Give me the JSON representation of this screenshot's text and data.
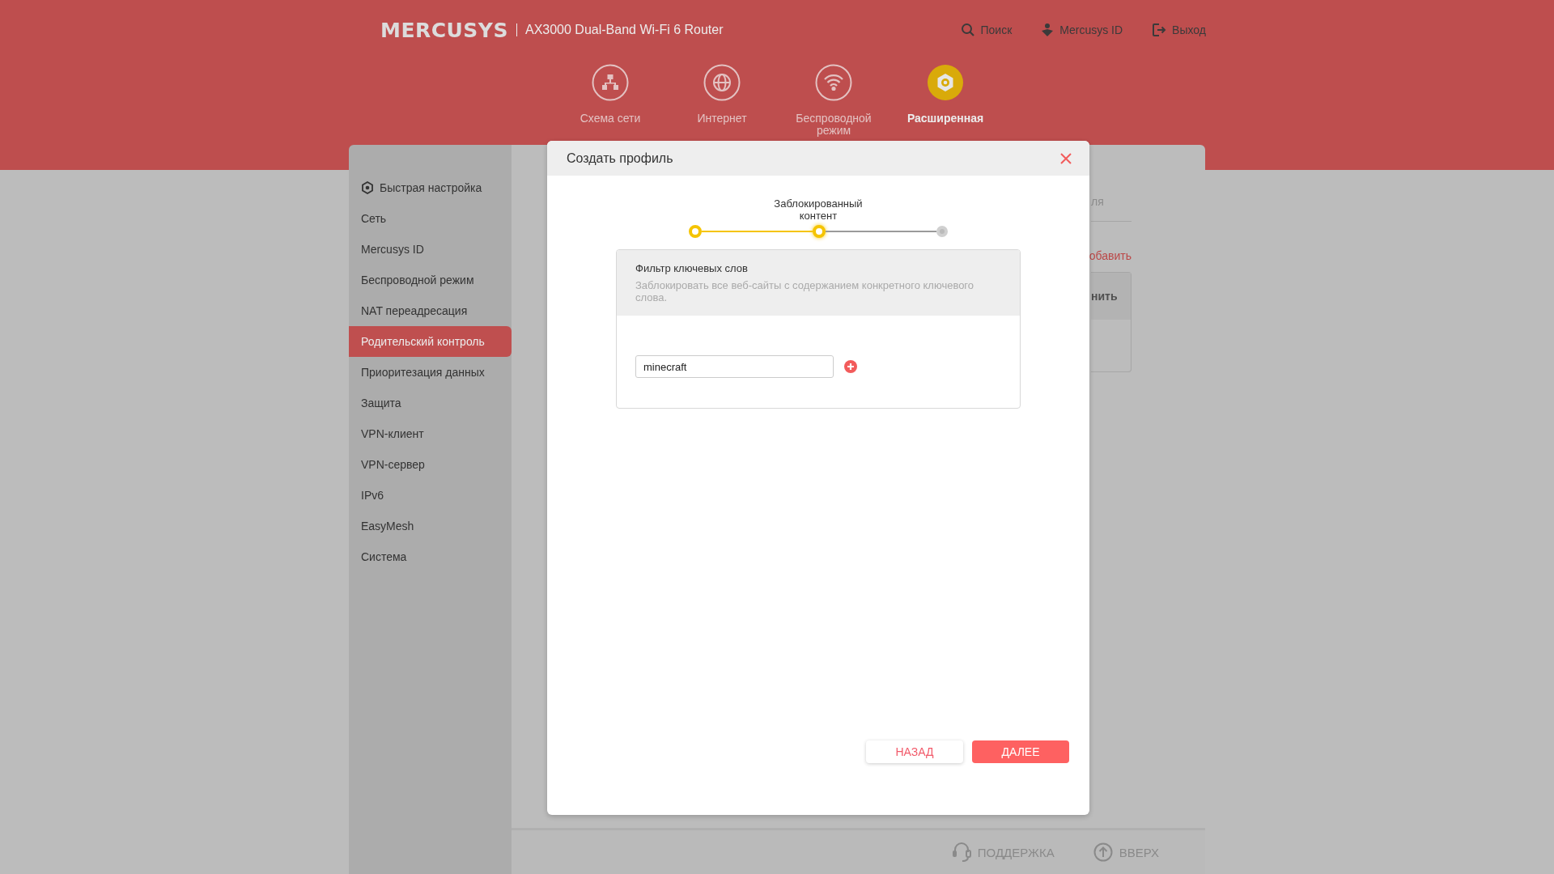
{
  "header": {
    "brand": "MERCUSYS",
    "model": "AX3000 Dual-Band Wi-Fi 6 Router",
    "links": [
      {
        "kind": "search",
        "label": "Поиск"
      },
      {
        "kind": "id",
        "label": "Mercusys ID"
      },
      {
        "kind": "logout",
        "label": "Выход"
      }
    ]
  },
  "nav": [
    {
      "kind": "network",
      "label": "Схема сети",
      "selected": false
    },
    {
      "kind": "internet",
      "label": "Интернет",
      "selected": false
    },
    {
      "kind": "wireless",
      "label": "Беспроводной режим",
      "selected": false
    },
    {
      "kind": "advanced",
      "label": "Расширенная",
      "selected": true
    }
  ],
  "sidebar": {
    "items": [
      {
        "label": "Быстрая настройка",
        "icon": true,
        "selected": false
      },
      {
        "label": "Сеть",
        "selected": false
      },
      {
        "label": "Mercusys ID",
        "selected": false
      },
      {
        "label": "Беспроводной режим",
        "selected": false
      },
      {
        "label": "NAT переадресация",
        "selected": false
      },
      {
        "label": "Родительский контроль",
        "selected": true
      },
      {
        "label": "Приоритезация данных",
        "selected": false
      },
      {
        "label": "Защита",
        "selected": false
      },
      {
        "label": "VPN-клиент",
        "selected": false
      },
      {
        "label": "VPN-сервер",
        "selected": false
      },
      {
        "label": "IPv6",
        "selected": false
      },
      {
        "label": "EasyMesh",
        "selected": false
      },
      {
        "label": "Система",
        "selected": false
      }
    ]
  },
  "background_content": {
    "heading_fragment": "ля",
    "add_link_fragment": "обавить",
    "table_header_fragment": "нить"
  },
  "dialog": {
    "title": "Создать профиль",
    "steps": [
      {
        "completed": true,
        "current": false
      },
      {
        "completed": true,
        "current": true,
        "label": "Заблокированный контент"
      },
      {
        "completed": false,
        "current": false
      }
    ],
    "section": {
      "title": "Фильтр ключевых слов",
      "description": "Заблокировать все веб-сайты с содержанием конкретного ключевого слова.",
      "keywords": [
        {
          "value": "minecraft"
        }
      ]
    },
    "buttons": [
      {
        "kind": "secondary",
        "label": "НАЗАД"
      },
      {
        "kind": "primary",
        "label": "ДАЛЕЕ"
      }
    ]
  },
  "footer": {
    "links": [
      {
        "kind": "support",
        "label": "ПОДДЕРЖКА"
      },
      {
        "kind": "top",
        "label": "ВВЕРХ"
      }
    ]
  }
}
